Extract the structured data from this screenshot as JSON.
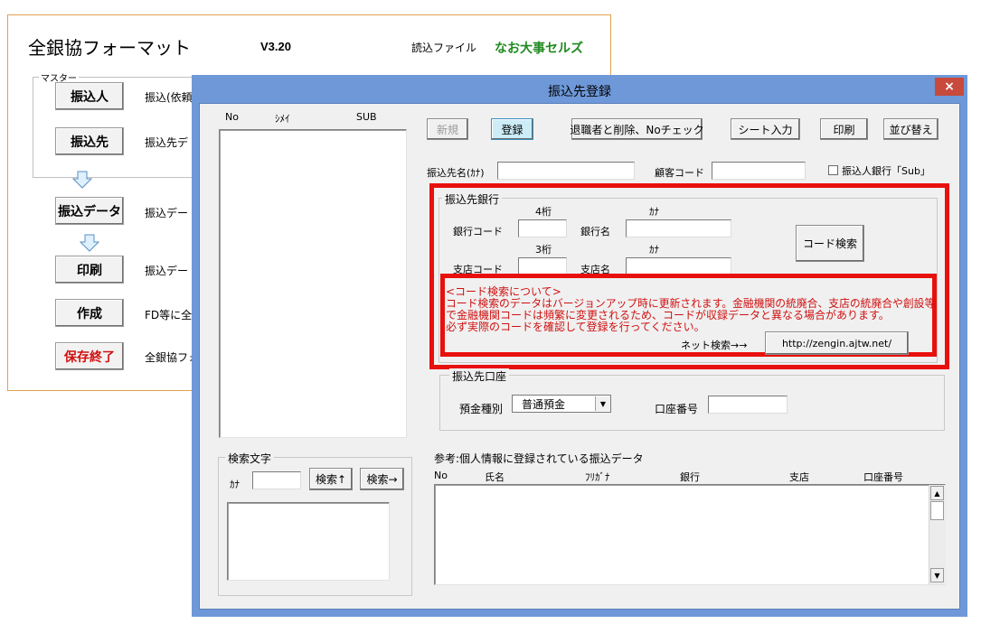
{
  "sheet": {
    "title": "全銀協フォーマット",
    "version": "V3.20",
    "file_label": "読込ファイル",
    "file_name": "なお大事セルズ",
    "master_label": "マスター",
    "buttons": [
      {
        "label": "振込人",
        "desc": "振込(依頼"
      },
      {
        "label": "振込先",
        "desc": "振込先デ"
      },
      {
        "label": "振込データ",
        "desc": "振込デー"
      },
      {
        "label": "印刷",
        "desc": "振込デー"
      },
      {
        "label": "作成",
        "desc": "FD等に全"
      },
      {
        "label": "保存終了",
        "desc": "全銀協フォ"
      }
    ]
  },
  "dialog": {
    "title": "振込先登録",
    "close": "×",
    "list_headers": {
      "no": "No",
      "kana": "ｼﾒｲ",
      "sub": "SUB"
    },
    "toolbar": {
      "new": "新規",
      "register": "登録",
      "delete": "退職者と削除、Noチェック",
      "sheet_input": "シート入力",
      "print": "印刷",
      "sort": "並び替え"
    },
    "payee_kana_label": "振込先名(ｶﾅ)",
    "customer_code_label": "顧客コード",
    "payer_bank_sub_label": "振込人銀行「Sub」",
    "bank_frame": {
      "title": "振込先銀行",
      "digits4": "4桁",
      "kana1": "ｶﾅ",
      "bank_code_label": "銀行コード",
      "bank_name_label": "銀行名",
      "digits3": "3桁",
      "kana2": "ｶﾅ",
      "branch_code_label": "支店コード",
      "branch_name_label": "支店名",
      "code_search": "コード検索"
    },
    "notice": {
      "line1": "<コード検索について>",
      "line2": "コード検索のデータはバージョンアップ時に更新されます。金融機関の統廃合、支店の統廃合や創設等",
      "line3": "で金融機関コードは頻繁に変更されるため、コードが収録データと異なる場合があります。",
      "line4": "必ず実際のコードを確認して登録を行ってください。",
      "net_search_label": "ネット検索→→",
      "url_button": "http://zengin.ajtw.net/"
    },
    "account_frame": {
      "title": "振込先口座",
      "deposit_type_label": "預金種別",
      "deposit_type_value": "普通預金",
      "account_no_label": "口座番号"
    },
    "search_frame": {
      "title": "検索文字",
      "kana_label": "ｶﾅ",
      "search_up": "検索↑",
      "search_right": "検索→"
    },
    "reference": {
      "title": "参考:個人情報に登録されている振込データ",
      "columns": [
        "No",
        "氏名",
        "ﾌﾘｶﾞﾅ",
        "銀行",
        "支店",
        "口座番号"
      ]
    }
  },
  "colors": {
    "titlebar": "#6e98d8",
    "close": "#c74a3c",
    "highlight": "#e8100c",
    "notice_text": "#d01010",
    "brand_green": "#1f8a1f",
    "sheet_border": "#e0a050"
  }
}
